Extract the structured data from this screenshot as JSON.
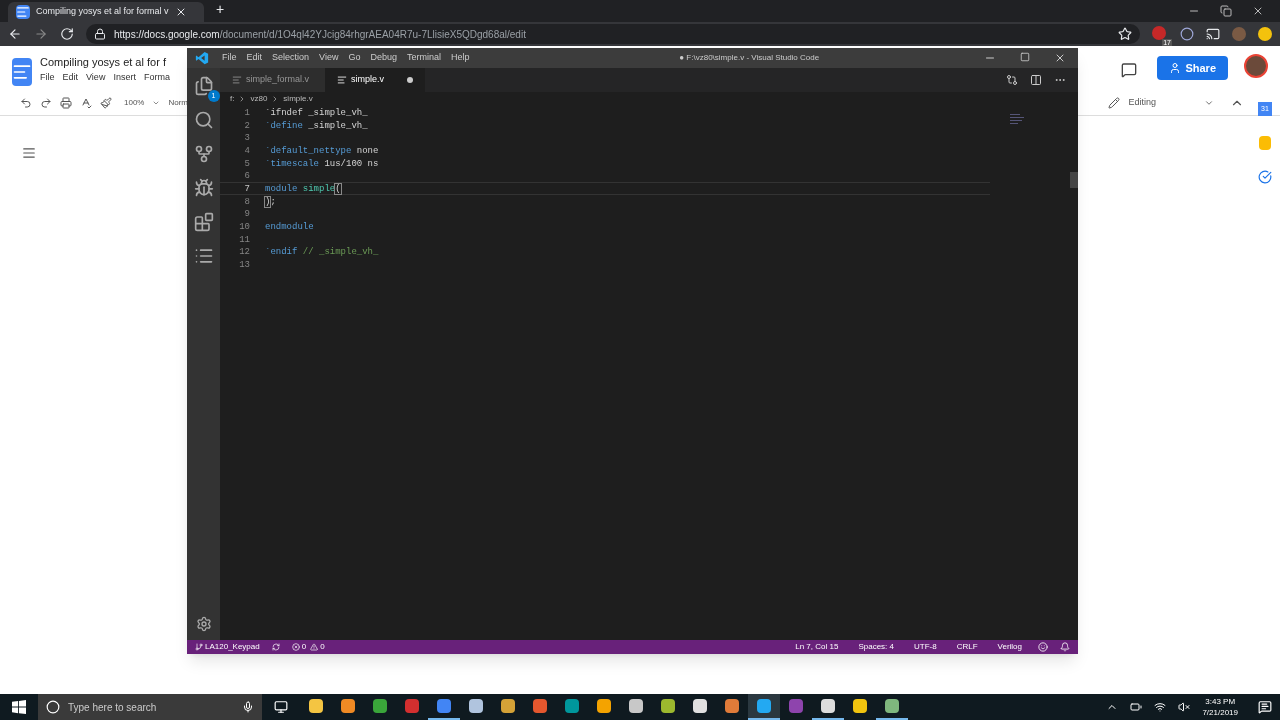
{
  "browser": {
    "tab_title": "Compiling yosys et al for formal v",
    "new_tab": "+",
    "url_host": "https://docs.google.com",
    "url_path": "/document/d/1O4ql42YJcig84rhgrAEA04R7u-7LlisieX5QDgd68al/edit",
    "extension_badge": "17"
  },
  "docs": {
    "title": "Compiling yosys et al for f",
    "menu": [
      "File",
      "Edit",
      "View",
      "Insert",
      "Forma"
    ],
    "zoom": "100%",
    "style": "Norm",
    "share": "Share",
    "mode": "Editing",
    "calendar_day": "31"
  },
  "vscode": {
    "menu": [
      "File",
      "Edit",
      "Selection",
      "View",
      "Go",
      "Debug",
      "Terminal",
      "Help"
    ],
    "title": "● F:\\vz80\\simple.v - Visual Studio Code",
    "explorer_badge": "1",
    "tabs": [
      {
        "label": "simple_formal.v",
        "selected": false,
        "modified": false
      },
      {
        "label": "simple.v",
        "selected": true,
        "modified": true
      }
    ],
    "breadcrumb": [
      "f:",
      "vz80",
      "simple.v"
    ],
    "lines": [
      {
        "number": "1",
        "current": false,
        "tokens": [
          {
            "kind": "plain",
            "text": "`ifndef _simple_vh_"
          }
        ]
      },
      {
        "number": "2",
        "current": false,
        "tokens": [
          {
            "kind": "directive",
            "text": "`define"
          },
          {
            "kind": "plain",
            "text": " _simple_vh_"
          }
        ]
      },
      {
        "number": "3",
        "current": false
      },
      {
        "number": "4",
        "current": false,
        "tokens": [
          {
            "kind": "directive",
            "text": "`default_nettype"
          },
          {
            "kind": "plain",
            "text": " none"
          }
        ]
      },
      {
        "number": "5",
        "current": false,
        "tokens": [
          {
            "kind": "directive",
            "text": "`timescale"
          },
          {
            "kind": "plain",
            "text": " 1us/100 ns"
          }
        ]
      },
      {
        "number": "6",
        "current": false
      },
      {
        "number": "7",
        "current": true,
        "tokens": [
          {
            "kind": "keyword",
            "text": "module"
          },
          {
            "kind": "name",
            "text": " simple"
          },
          {
            "kind": "bracket",
            "text": "("
          }
        ]
      },
      {
        "number": "8",
        "current": false,
        "tokens": [
          {
            "kind": "bracket",
            "text": ")"
          },
          {
            "kind": "plain",
            "text": ";"
          }
        ]
      },
      {
        "number": "9",
        "current": false
      },
      {
        "number": "10",
        "current": false,
        "tokens": [
          {
            "kind": "keyword",
            "text": "endmodule"
          }
        ]
      },
      {
        "number": "11",
        "current": false
      },
      {
        "number": "12",
        "current": false,
        "tokens": [
          {
            "kind": "directive",
            "text": "`endif"
          },
          {
            "kind": "comment",
            "text": " // _simple_vh_"
          }
        ]
      },
      {
        "number": "13",
        "current": false
      }
    ],
    "status": {
      "branch": "LA120_Keypad",
      "errors": "0",
      "warnings": "0",
      "right": [
        "Ln 7, Col 15",
        "Spaces: 4",
        "UTF-8",
        "CRLF",
        "Verilog"
      ]
    }
  },
  "taskbar": {
    "search_placeholder": "Type here to search",
    "time": "3:43 PM",
    "date": "7/21/2019",
    "apps": [
      {
        "color": "#f4c542",
        "running": false,
        "selected": false
      },
      {
        "color": "#f08a24",
        "running": false,
        "selected": false
      },
      {
        "color": "#3aa53a",
        "running": false,
        "selected": false
      },
      {
        "color": "#d32f2f",
        "running": false,
        "selected": false
      },
      {
        "color": "#4285f4",
        "running": true,
        "selected": false
      },
      {
        "color": "#b0c4de",
        "running": false,
        "selected": false
      },
      {
        "color": "#d4a237",
        "running": false,
        "selected": false
      },
      {
        "color": "#e4572e",
        "running": false,
        "selected": false
      },
      {
        "color": "#00979c",
        "running": false,
        "selected": false
      },
      {
        "color": "#f4a300",
        "running": false,
        "selected": false
      },
      {
        "color": "#c8c8c8",
        "running": false,
        "selected": false
      },
      {
        "color": "#9cb82e",
        "running": false,
        "selected": false
      },
      {
        "color": "#e0e0e0",
        "running": false,
        "selected": false
      },
      {
        "color": "#e07b39",
        "running": false,
        "selected": false
      },
      {
        "color": "#23a9f2",
        "running": true,
        "selected": true
      },
      {
        "color": "#8e44ad",
        "running": false,
        "selected": false
      },
      {
        "color": "#dddddd",
        "running": true,
        "selected": false
      },
      {
        "color": "#f1c40f",
        "running": false,
        "selected": false
      },
      {
        "color": "#7fb77e",
        "running": true,
        "selected": false
      }
    ]
  }
}
